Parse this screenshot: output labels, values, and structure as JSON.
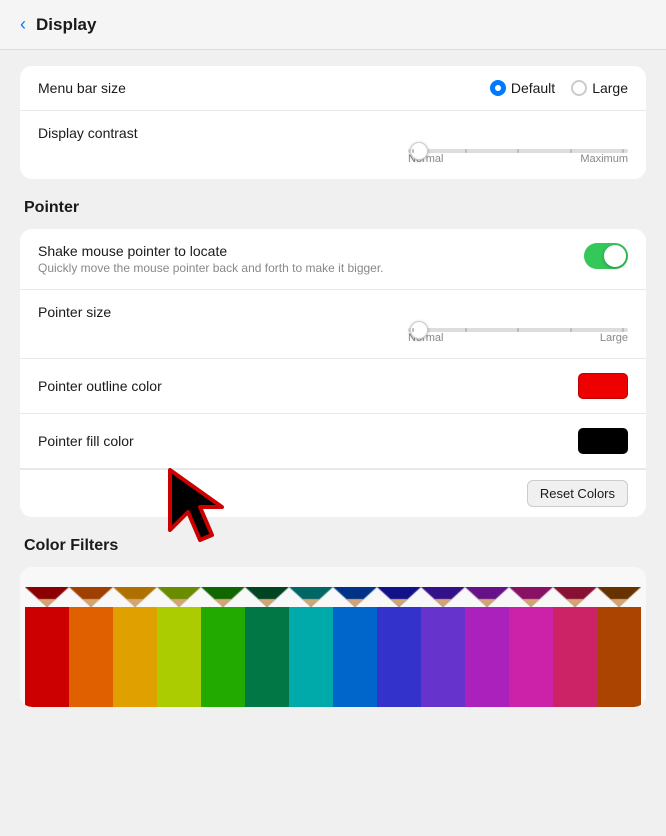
{
  "header": {
    "back_label": "Display",
    "back_icon": "‹"
  },
  "display": {
    "menu_bar_size": {
      "label": "Menu bar size",
      "options": [
        {
          "id": "default",
          "label": "Default",
          "selected": true
        },
        {
          "id": "large",
          "label": "Large",
          "selected": false
        }
      ]
    },
    "display_contrast": {
      "label": "Display contrast",
      "min_label": "Normal",
      "max_label": "Maximum"
    }
  },
  "pointer": {
    "section_label": "Pointer",
    "shake": {
      "label": "Shake mouse pointer to locate",
      "sublabel": "Quickly move the mouse pointer back and forth to make it bigger.",
      "enabled": true
    },
    "pointer_size": {
      "label": "Pointer size",
      "min_label": "Normal",
      "max_label": "Large"
    },
    "outline_color": {
      "label": "Pointer outline color",
      "color": "#ee0000"
    },
    "fill_color": {
      "label": "Pointer fill color",
      "color": "#000000"
    },
    "reset_btn": "Reset Colors"
  },
  "color_filters": {
    "section_label": "Color Filters"
  },
  "pencils": [
    {
      "color": "#cc0000",
      "tip": "#8b0000"
    },
    {
      "color": "#e06000",
      "tip": "#a04000"
    },
    {
      "color": "#e0a000",
      "tip": "#b07000"
    },
    {
      "color": "#aacc00",
      "tip": "#6a8c00"
    },
    {
      "color": "#22aa00",
      "tip": "#116600"
    },
    {
      "color": "#007744",
      "tip": "#004422"
    },
    {
      "color": "#00aaaa",
      "tip": "#006666"
    },
    {
      "color": "#0066cc",
      "tip": "#003388"
    },
    {
      "color": "#3333cc",
      "tip": "#111188"
    },
    {
      "color": "#6633cc",
      "tip": "#331188"
    },
    {
      "color": "#aa22bb",
      "tip": "#661188"
    },
    {
      "color": "#cc22aa",
      "tip": "#881166"
    },
    {
      "color": "#cc2266",
      "tip": "#881133"
    },
    {
      "color": "#aa4400",
      "tip": "#663300"
    }
  ]
}
